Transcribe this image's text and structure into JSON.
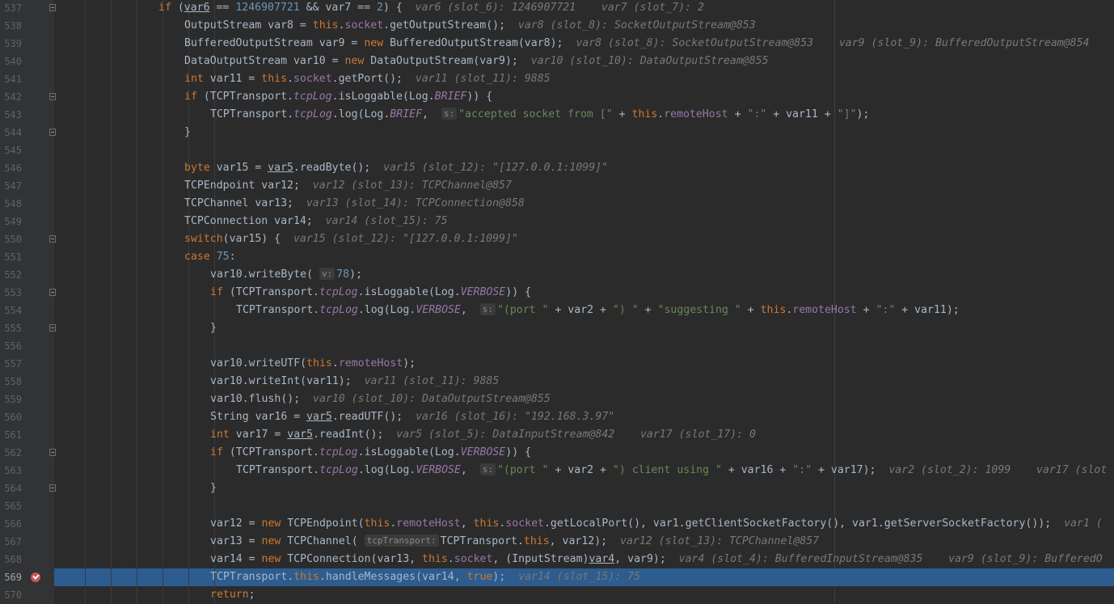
{
  "editor": {
    "current_line": 569,
    "breakpoint_line": 569,
    "fold_lines": [
      537,
      542,
      544,
      550,
      553,
      555,
      562,
      564
    ],
    "lines": [
      {
        "n": 537,
        "indent": 4,
        "segs": [
          [
            "kw",
            "if "
          ],
          [
            "",
            "("
          ],
          [
            "ul",
            "var6"
          ],
          [
            "",
            " == "
          ],
          [
            "num",
            "1246907721"
          ],
          [
            "",
            " && var7 == "
          ],
          [
            "num",
            "2"
          ],
          [
            "",
            ") {  "
          ],
          [
            "hint",
            "var6 (slot_6): 1246907721    var7 (slot_7): 2"
          ]
        ]
      },
      {
        "n": 538,
        "indent": 5,
        "segs": [
          [
            "",
            "OutputStream var8 = "
          ],
          [
            "kw",
            "this"
          ],
          [
            "",
            "."
          ],
          [
            "fld",
            "socket"
          ],
          [
            "",
            ".getOutputStream();  "
          ],
          [
            "hint",
            "var8 (slot_8): SocketOutputStream@853"
          ]
        ]
      },
      {
        "n": 539,
        "indent": 5,
        "segs": [
          [
            "",
            "BufferedOutputStream var9 = "
          ],
          [
            "kw",
            "new "
          ],
          [
            "",
            "BufferedOutputStream(var8);  "
          ],
          [
            "hint",
            "var8 (slot_8): SocketOutputStream@853    var9 (slot_9): BufferedOutputStream@854"
          ]
        ]
      },
      {
        "n": 540,
        "indent": 5,
        "segs": [
          [
            "",
            "DataOutputStream var10 = "
          ],
          [
            "kw",
            "new "
          ],
          [
            "",
            "DataOutputStream(var9);  "
          ],
          [
            "hint",
            "var10 (slot_10): DataOutputStream@855"
          ]
        ]
      },
      {
        "n": 541,
        "indent": 5,
        "segs": [
          [
            "kw",
            "int "
          ],
          [
            "",
            "var11 = "
          ],
          [
            "kw",
            "this"
          ],
          [
            "",
            "."
          ],
          [
            "fld",
            "socket"
          ],
          [
            "",
            ".getPort();  "
          ],
          [
            "hint",
            "var11 (slot_11): 9885"
          ]
        ]
      },
      {
        "n": 542,
        "indent": 5,
        "segs": [
          [
            "kw",
            "if "
          ],
          [
            "",
            "(TCPTransport."
          ],
          [
            "sfld",
            "tcpLog"
          ],
          [
            "",
            ".isLoggable(Log."
          ],
          [
            "sfld",
            "BRIEF"
          ],
          [
            "",
            ")) {"
          ]
        ]
      },
      {
        "n": 543,
        "indent": 6,
        "segs": [
          [
            "",
            "TCPTransport."
          ],
          [
            "sfld",
            "tcpLog"
          ],
          [
            "",
            ".log(Log."
          ],
          [
            "sfld",
            "BRIEF"
          ],
          [
            "",
            ",  "
          ],
          [
            "ph",
            "s:"
          ],
          [
            "str",
            "\"accepted socket from [\""
          ],
          [
            "",
            " + "
          ],
          [
            "kw",
            "this"
          ],
          [
            "",
            "."
          ],
          [
            "fld",
            "remoteHost"
          ],
          [
            "",
            " + "
          ],
          [
            "str",
            "\":\""
          ],
          [
            "",
            " + var11 + "
          ],
          [
            "str",
            "\"]\""
          ],
          [
            "",
            ");"
          ]
        ]
      },
      {
        "n": 544,
        "indent": 5,
        "segs": [
          [
            "",
            "}"
          ]
        ]
      },
      {
        "n": 545,
        "indent": 0,
        "segs": []
      },
      {
        "n": 546,
        "indent": 5,
        "segs": [
          [
            "kw",
            "byte "
          ],
          [
            "",
            "var15 = "
          ],
          [
            "ul",
            "var5"
          ],
          [
            "",
            ".readByte();  "
          ],
          [
            "hint",
            "var15 (slot_12): \"[127.0.0.1:1099]\""
          ]
        ]
      },
      {
        "n": 547,
        "indent": 5,
        "segs": [
          [
            "",
            "TCPEndpoint var12;  "
          ],
          [
            "hint",
            "var12 (slot_13): TCPChannel@857"
          ]
        ]
      },
      {
        "n": 548,
        "indent": 5,
        "segs": [
          [
            "",
            "TCPChannel var13;  "
          ],
          [
            "hint",
            "var13 (slot_14): TCPConnection@858"
          ]
        ]
      },
      {
        "n": 549,
        "indent": 5,
        "segs": [
          [
            "",
            "TCPConnection var14;  "
          ],
          [
            "hint",
            "var14 (slot_15): 75"
          ]
        ]
      },
      {
        "n": 550,
        "indent": 5,
        "segs": [
          [
            "kw",
            "switch"
          ],
          [
            "",
            "(var15) {  "
          ],
          [
            "hint",
            "var15 (slot_12): \"[127.0.0.1:1099]\""
          ]
        ]
      },
      {
        "n": 551,
        "indent": 5,
        "segs": [
          [
            "kw",
            "case "
          ],
          [
            "num",
            "75"
          ],
          [
            "",
            ":"
          ]
        ]
      },
      {
        "n": 552,
        "indent": 6,
        "segs": [
          [
            "",
            "var10.writeByte( "
          ],
          [
            "ph",
            "v:"
          ],
          [
            "num",
            "78"
          ],
          [
            "",
            ");"
          ]
        ]
      },
      {
        "n": 553,
        "indent": 6,
        "segs": [
          [
            "kw",
            "if "
          ],
          [
            "",
            "(TCPTransport."
          ],
          [
            "sfld",
            "tcpLog"
          ],
          [
            "",
            ".isLoggable(Log."
          ],
          [
            "sfld",
            "VERBOSE"
          ],
          [
            "",
            ")) {"
          ]
        ]
      },
      {
        "n": 554,
        "indent": 7,
        "segs": [
          [
            "",
            "TCPTransport."
          ],
          [
            "sfld",
            "tcpLog"
          ],
          [
            "",
            ".log(Log."
          ],
          [
            "sfld",
            "VERBOSE"
          ],
          [
            "",
            ",  "
          ],
          [
            "ph",
            "s:"
          ],
          [
            "str",
            "\"(port \""
          ],
          [
            "",
            " + var2 + "
          ],
          [
            "str",
            "\") \""
          ],
          [
            "",
            " + "
          ],
          [
            "str",
            "\"suggesting \""
          ],
          [
            "",
            " + "
          ],
          [
            "kw",
            "this"
          ],
          [
            "",
            "."
          ],
          [
            "fld",
            "remoteHost"
          ],
          [
            "",
            " + "
          ],
          [
            "str",
            "\":\""
          ],
          [
            "",
            " + var11);"
          ]
        ]
      },
      {
        "n": 555,
        "indent": 6,
        "segs": [
          [
            "",
            "}"
          ]
        ]
      },
      {
        "n": 556,
        "indent": 0,
        "segs": []
      },
      {
        "n": 557,
        "indent": 6,
        "segs": [
          [
            "",
            "var10.writeUTF("
          ],
          [
            "kw",
            "this"
          ],
          [
            "",
            "."
          ],
          [
            "fld",
            "remoteHost"
          ],
          [
            "",
            ");"
          ]
        ]
      },
      {
        "n": 558,
        "indent": 6,
        "segs": [
          [
            "",
            "var10.writeInt(var11);  "
          ],
          [
            "hint",
            "var11 (slot_11): 9885"
          ]
        ]
      },
      {
        "n": 559,
        "indent": 6,
        "segs": [
          [
            "",
            "var10.flush();  "
          ],
          [
            "hint",
            "var10 (slot_10): DataOutputStream@855"
          ]
        ]
      },
      {
        "n": 560,
        "indent": 6,
        "segs": [
          [
            "",
            "String var16 = "
          ],
          [
            "ul",
            "var5"
          ],
          [
            "",
            ".readUTF();  "
          ],
          [
            "hint",
            "var16 (slot_16): \"192.168.3.97\""
          ]
        ]
      },
      {
        "n": 561,
        "indent": 6,
        "segs": [
          [
            "kw",
            "int "
          ],
          [
            "",
            "var17 = "
          ],
          [
            "ul",
            "var5"
          ],
          [
            "",
            ".readInt();  "
          ],
          [
            "hint",
            "var5 (slot_5): DataInputStream@842    var17 (slot_17): 0"
          ]
        ]
      },
      {
        "n": 562,
        "indent": 6,
        "segs": [
          [
            "kw",
            "if "
          ],
          [
            "",
            "(TCPTransport."
          ],
          [
            "sfld",
            "tcpLog"
          ],
          [
            "",
            ".isLoggable(Log."
          ],
          [
            "sfld",
            "VERBOSE"
          ],
          [
            "",
            ")) {"
          ]
        ]
      },
      {
        "n": 563,
        "indent": 7,
        "segs": [
          [
            "",
            "TCPTransport."
          ],
          [
            "sfld",
            "tcpLog"
          ],
          [
            "",
            ".log(Log."
          ],
          [
            "sfld",
            "VERBOSE"
          ],
          [
            "",
            ",  "
          ],
          [
            "ph",
            "s:"
          ],
          [
            "str",
            "\"(port \""
          ],
          [
            "",
            " + var2 + "
          ],
          [
            "str",
            "\") client using \""
          ],
          [
            "",
            " + var16 + "
          ],
          [
            "str",
            "\":\""
          ],
          [
            "",
            " + var17);  "
          ],
          [
            "hint",
            "var2 (slot_2): 1099    var17 (slot"
          ]
        ]
      },
      {
        "n": 564,
        "indent": 6,
        "segs": [
          [
            "",
            "}"
          ]
        ]
      },
      {
        "n": 565,
        "indent": 0,
        "segs": []
      },
      {
        "n": 566,
        "indent": 6,
        "segs": [
          [
            "",
            "var12 = "
          ],
          [
            "kw",
            "new "
          ],
          [
            "",
            "TCPEndpoint("
          ],
          [
            "kw",
            "this"
          ],
          [
            "",
            "."
          ],
          [
            "fld",
            "remoteHost"
          ],
          [
            "",
            ", "
          ],
          [
            "kw",
            "this"
          ],
          [
            "",
            "."
          ],
          [
            "fld",
            "socket"
          ],
          [
            "",
            ".getLocalPort(), var1.getClientSocketFactory(), var1.getServerSocketFactory());  "
          ],
          [
            "hint",
            "var1 ("
          ]
        ]
      },
      {
        "n": 567,
        "indent": 6,
        "segs": [
          [
            "",
            "var13 = "
          ],
          [
            "kw",
            "new "
          ],
          [
            "",
            "TCPChannel( "
          ],
          [
            "ph",
            "tcpTransport:"
          ],
          [
            "",
            "TCPTransport."
          ],
          [
            "kw",
            "this"
          ],
          [
            "",
            ", var12);  "
          ],
          [
            "hint",
            "var12 (slot_13): TCPChannel@857"
          ]
        ]
      },
      {
        "n": 568,
        "indent": 6,
        "segs": [
          [
            "",
            "var14 = "
          ],
          [
            "kw",
            "new "
          ],
          [
            "",
            "TCPConnection(var13, "
          ],
          [
            "kw",
            "this"
          ],
          [
            "",
            "."
          ],
          [
            "fld",
            "socket"
          ],
          [
            "",
            ", (InputStream)"
          ],
          [
            "ul",
            "var4"
          ],
          [
            "",
            ", var9);  "
          ],
          [
            "hint",
            "var4 (slot_4): BufferedInputStream@835    var9 (slot_9): BufferedO"
          ]
        ]
      },
      {
        "n": 569,
        "indent": 6,
        "segs": [
          [
            "",
            "TCPTransport."
          ],
          [
            "kw",
            "this"
          ],
          [
            "",
            ".handleMessages(var14, "
          ],
          [
            "kw",
            "true"
          ],
          [
            "",
            ");  "
          ],
          [
            "hint",
            "var14 (slot_15): 75"
          ]
        ]
      },
      {
        "n": 570,
        "indent": 6,
        "segs": [
          [
            "kw",
            "return"
          ],
          [
            "",
            ";"
          ]
        ]
      }
    ]
  }
}
